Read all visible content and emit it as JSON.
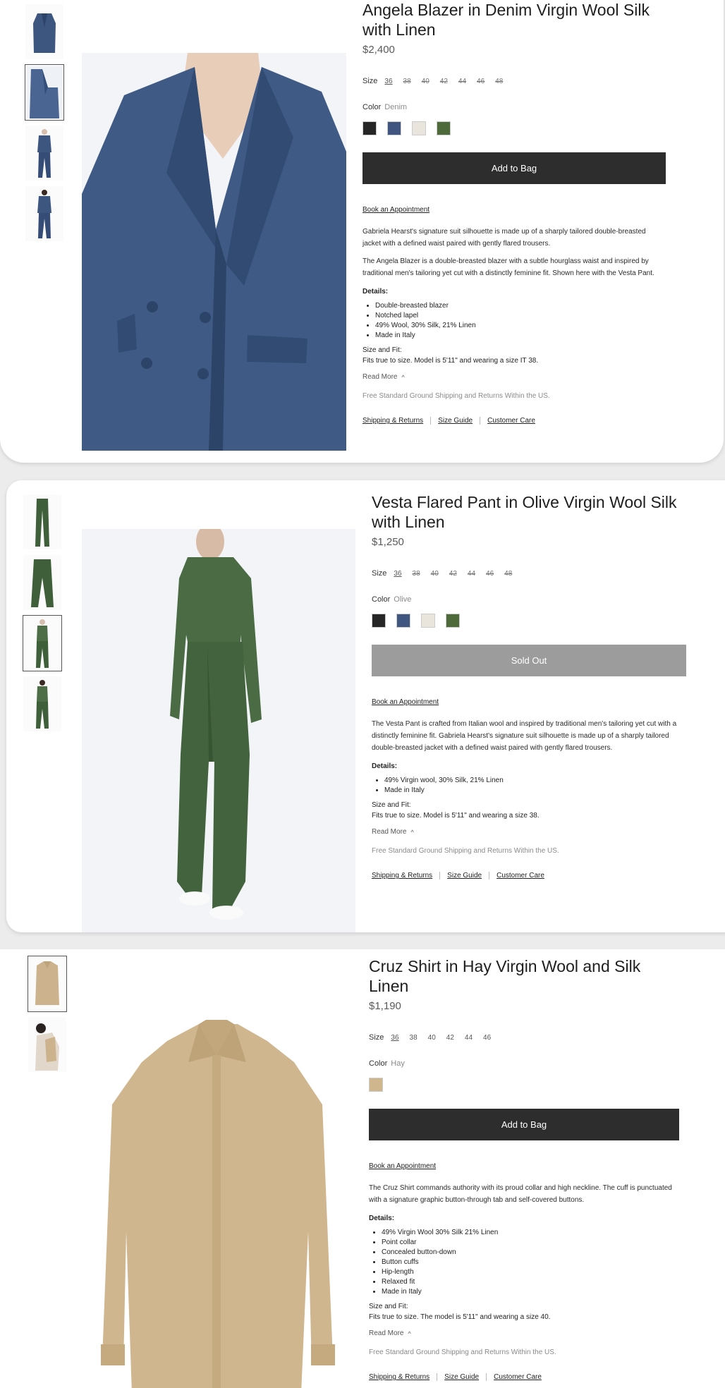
{
  "products": [
    {
      "title": "Angela Blazer in Denim Virgin Wool Silk with Linen",
      "price": "$2,400",
      "size_label": "Size",
      "sizes": [
        "36",
        "38",
        "40",
        "42",
        "44",
        "46",
        "48"
      ],
      "color_label": "Color",
      "color_value": "Denim",
      "swatch_colors": [
        "#262626",
        "#405680",
        "#e9e5dd",
        "#4e6a3a"
      ],
      "cta": "Add to Bag",
      "appointment": "Book an Appointment",
      "descriptions": [
        "Gabriela Hearst's signature suit silhouette is made up of a sharply tailored double-breasted jacket with a defined waist paired with gently flared trousers.",
        "The Angela Blazer is a double-breasted blazer with a subtle hourglass waist and inspired by traditional men's tailoring yet cut with a distinctly feminine fit. Shown here with the Vesta Pant."
      ],
      "details_label": "Details:",
      "details": [
        "Double-breasted blazer",
        "Notched lapel",
        "49% Wool, 30% Silk, 21% Linen",
        "Made in Italy"
      ],
      "fit_label": "Size and Fit:",
      "fit": "Fits true to size. Model is 5'11\" and wearing a size IT 38.",
      "read_more": "Read More",
      "shipping": "Free Standard Ground Shipping and Returns Within the US.",
      "links": [
        "Shipping & Returns",
        "Size Guide",
        "Customer Care"
      ]
    },
    {
      "title": "Vesta Flared Pant in Olive Virgin Wool Silk with Linen",
      "price": "$1,250",
      "size_label": "Size",
      "sizes": [
        "36",
        "38",
        "40",
        "42",
        "44",
        "46",
        "48"
      ],
      "color_label": "Color",
      "color_value": "Olive",
      "swatch_colors": [
        "#262626",
        "#405680",
        "#e9e5dd",
        "#4e6a3a"
      ],
      "cta": "Sold Out",
      "appointment": "Book an Appointment",
      "descriptions": [
        "The Vesta Pant is crafted from Italian wool and inspired by traditional men's tailoring yet cut with a distinctly feminine fit. Gabriela Hearst's signature suit silhouette is made up of a sharply tailored double-breasted jacket with a defined waist paired with gently flared trousers."
      ],
      "details_label": "Details:",
      "details": [
        "49% Virgin wool, 30% Silk, 21% Linen",
        "Made in Italy"
      ],
      "fit_label": "Size and Fit:",
      "fit": "Fits true to size. Model is 5'11\" and wearing a size 38.",
      "read_more": "Read More",
      "shipping": "Free Standard Ground Shipping and Returns Within the US.",
      "links": [
        "Shipping & Returns",
        "Size Guide",
        "Customer Care"
      ]
    },
    {
      "title": "Cruz Shirt in Hay Virgin Wool and Silk Linen",
      "price": "$1,190",
      "size_label": "Size",
      "sizes": [
        "36",
        "38",
        "40",
        "42",
        "44",
        "46"
      ],
      "color_label": "Color",
      "color_value": "Hay",
      "swatch_colors": [
        "#cfb68c"
      ],
      "cta": "Add to Bag",
      "appointment": "Book an Appointment",
      "descriptions": [
        "The Cruz Shirt commands authority with its proud collar and high neckline. The cuff is punctuated with a signature graphic button-through tab and self-covered buttons."
      ],
      "details_label": "Details:",
      "details": [
        "49% Virgin Wool 30% Silk 21% Linen",
        "Point collar",
        "Concealed button-down",
        "Button cuffs",
        "Hip-length",
        "Relaxed fit",
        "Made in Italy"
      ],
      "fit_label": "Size and Fit:",
      "fit": "Fits true to size. The model is 5'11\" and wearing a size 40.",
      "read_more": "Read More",
      "shipping": "Free Standard Ground Shipping and Returns Within the US.",
      "links": [
        "Shipping & Returns",
        "Size Guide",
        "Customer Care"
      ]
    }
  ]
}
